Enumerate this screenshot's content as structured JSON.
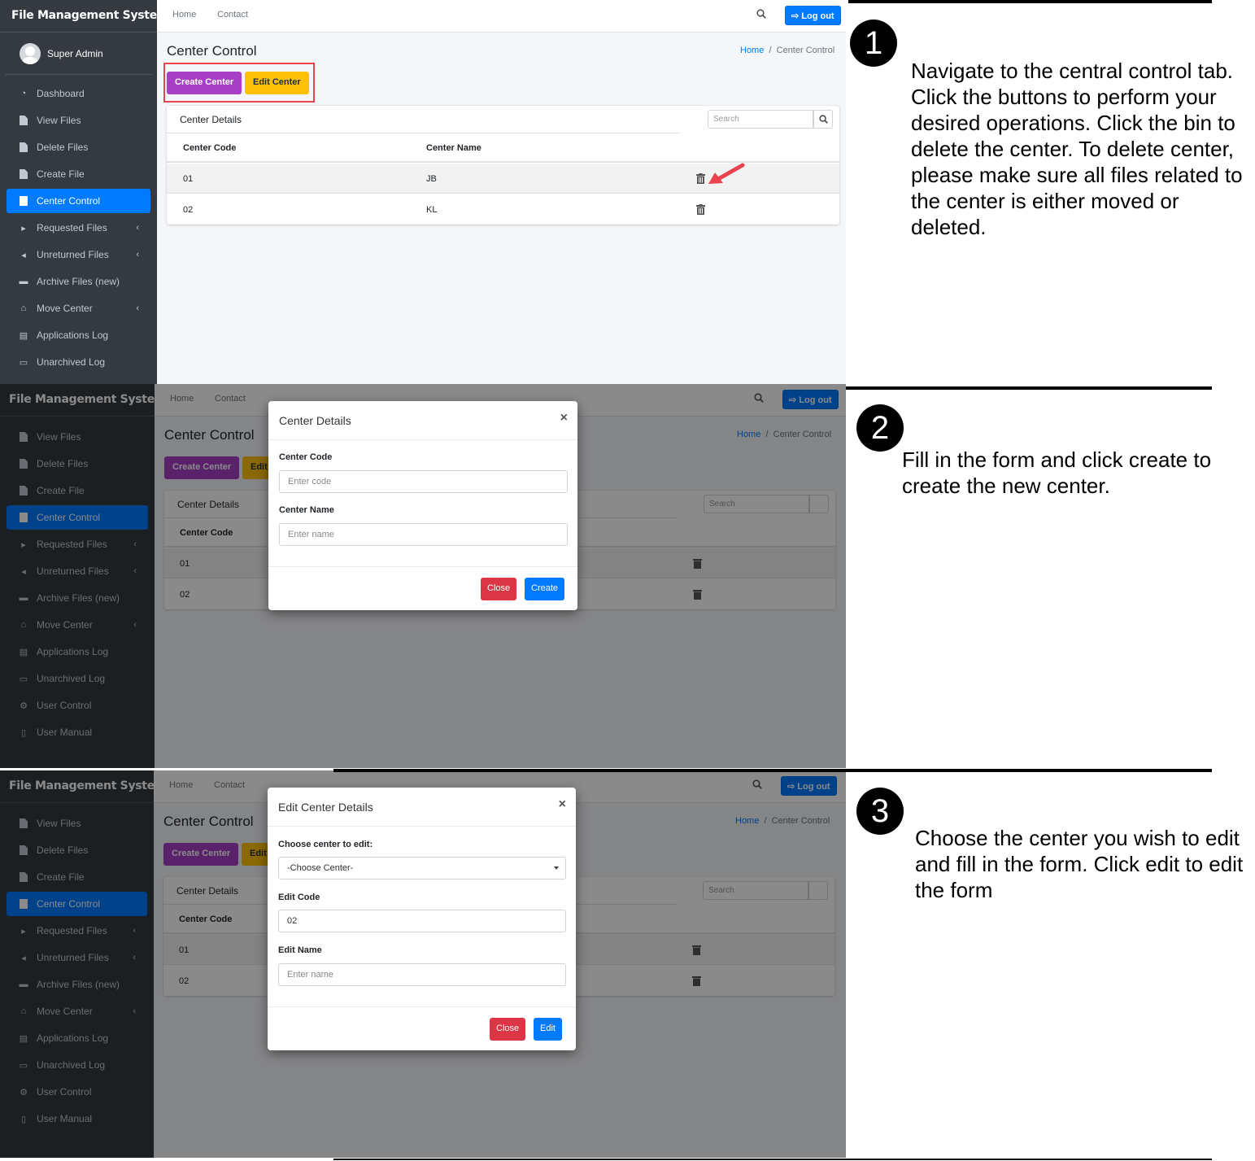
{
  "app": {
    "brand": "File Management System",
    "user": "Super Admin"
  },
  "topbar": {
    "home": "Home",
    "contact": "Contact",
    "logout": "Log out"
  },
  "page": {
    "title": "Center Control",
    "breadcrumb_home": "Home",
    "breadcrumb_current": "Center Control"
  },
  "buttons": {
    "create": "Create Center",
    "edit": "Edit Center",
    "edit_partial": "Edit"
  },
  "card": {
    "title": "Center Details",
    "search_placeholder": "Search"
  },
  "table": {
    "headers": [
      "Center Code",
      "Center Name"
    ],
    "rows": [
      {
        "code": "01",
        "name": "JB"
      },
      {
        "code": "02",
        "name": "KL"
      }
    ]
  },
  "sidebar_step1": [
    "Dashboard",
    "View Files",
    "Delete Files",
    "Create File",
    "Center Control",
    "Requested Files",
    "Unreturned Files",
    "Archive Files (new)",
    "Move Center",
    "Applications Log",
    "Unarchived Log"
  ],
  "sidebar_step23": [
    "View Files",
    "Delete Files",
    "Create File",
    "Center Control",
    "Requested Files",
    "Unreturned Files",
    "Archive Files (new)",
    "Move Center",
    "Applications Log",
    "Unarchived Log",
    "User Control",
    "User Manual"
  ],
  "modal_create": {
    "title": "Center Details",
    "close_x": "×",
    "code_label": "Center Code",
    "code_placeholder": "Enter code",
    "name_label": "Center Name",
    "name_placeholder": "Enter name",
    "close": "Close",
    "submit": "Create"
  },
  "modal_edit": {
    "title": "Edit Center Details",
    "close_x": "×",
    "choose_label": "Choose center to edit:",
    "choose_value": "-Choose Center-",
    "code_label": "Edit Code",
    "code_value": "02",
    "name_label": "Edit Name",
    "name_placeholder": "Enter name",
    "close": "Close",
    "submit": "Edit"
  },
  "steps": [
    {
      "number": "1",
      "text": "Navigate to the central control tab. Click the buttons to perform your desired operations. Click the bin to delete the center. To delete center, please make sure all files related to the center is either moved or deleted."
    },
    {
      "number": "2",
      "text": "Fill in the form and click create to create the new center."
    },
    {
      "number": "3",
      "text": "Choose the center you wish to edit and fill in the form. Click edit to edit the form"
    }
  ],
  "colors": {
    "sidebar": "#343a40",
    "active": "#007bff",
    "create_btn": "#a83fc7",
    "edit_btn": "#ffc107",
    "highlight": "#e8434f",
    "close_btn": "#dc3545"
  },
  "icons": [
    "dashboard-icon",
    "file-icon",
    "building-icon",
    "file-export-icon",
    "file-import-icon",
    "archive-icon",
    "dolly-icon",
    "clipboard-icon",
    "box-open-icon",
    "users-cog-icon",
    "book-icon",
    "trash-icon",
    "search-icon",
    "sign-out-icon",
    "red-arrow-icon"
  ]
}
